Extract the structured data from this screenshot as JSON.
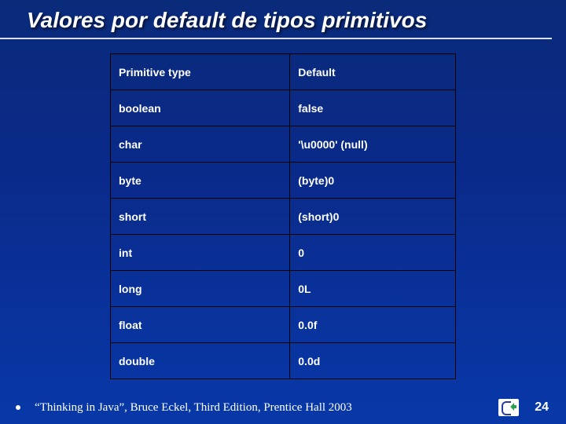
{
  "title": "Valores por default de tipos primitivos",
  "table": {
    "headers": {
      "type": "Primitive type",
      "default": "Default"
    },
    "rows": [
      {
        "type": "boolean",
        "default": "false"
      },
      {
        "type": "char",
        "default": "'\\u0000' (null)"
      },
      {
        "type": "byte",
        "default": "(byte)0"
      },
      {
        "type": "short",
        "default": "(short)0"
      },
      {
        "type": "int",
        "default": "0"
      },
      {
        "type": "long",
        "default": "0L"
      },
      {
        "type": "float",
        "default": "0.0f"
      },
      {
        "type": "double",
        "default": "0.0d"
      }
    ]
  },
  "citation": "“Thinking in Java”, Bruce Eckel, Third Edition, Prentice Hall 2003",
  "page_number": "24"
}
